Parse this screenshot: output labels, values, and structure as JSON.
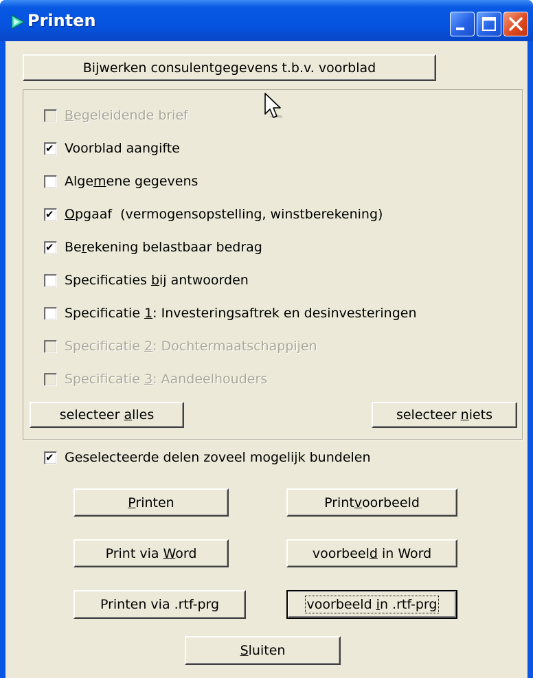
{
  "window": {
    "title": "Printen",
    "accent": "#0a55e3",
    "face": "#ece9d8"
  },
  "titlebar_buttons": [
    {
      "name": "minimize-icon"
    },
    {
      "name": "maximize-icon"
    },
    {
      "name": "close-icon"
    }
  ],
  "update_button": {
    "label": "Bijwerken consulentgegevens t.b.v. voorblad"
  },
  "sections": [
    {
      "pre": "",
      "key": "B",
      "post": "egeleidende brief",
      "checked": false,
      "enabled": false
    },
    {
      "pre": "Voorblad aan",
      "key": "g",
      "post": "ifte",
      "checked": true,
      "enabled": true
    },
    {
      "pre": "Alge",
      "key": "m",
      "post": "ene gegevens",
      "checked": false,
      "enabled": true
    },
    {
      "pre": "",
      "key": "O",
      "post": "pgaaf  (vermogensopstelling, winstberekening)",
      "checked": true,
      "enabled": true
    },
    {
      "pre": "Be",
      "key": "r",
      "post": "ekening belastbaar bedrag",
      "checked": true,
      "enabled": true
    },
    {
      "pre": "Specificaties ",
      "key": "b",
      "post": "ij antwoorden",
      "checked": false,
      "enabled": true
    },
    {
      "pre": "Specificatie ",
      "key": "1",
      "post": ": Investeringsaftrek en desinvesteringen",
      "checked": false,
      "enabled": true
    },
    {
      "pre": "Specificatie ",
      "key": "2",
      "post": ": Dochtermaatschappijen",
      "checked": false,
      "enabled": false
    },
    {
      "pre": "Specificatie ",
      "key": "3",
      "post": ": Aandeelhouders",
      "checked": false,
      "enabled": false
    }
  ],
  "select_all": {
    "pre": "selecteer ",
    "key": "a",
    "post": "lles"
  },
  "select_none": {
    "pre": "selecteer ",
    "key": "n",
    "post": "iets"
  },
  "bundle": {
    "label": "Geselecteerde delen zoveel mogelijk bundelen",
    "checked": true
  },
  "actions": {
    "print": {
      "pre": "",
      "key": "P",
      "post": "rinten"
    },
    "preview": {
      "pre": "Print",
      "key": "v",
      "post": "oorbeeld"
    },
    "print_word": {
      "pre": "Print via ",
      "key": "W",
      "post": "ord"
    },
    "preview_word": {
      "pre": "voorbeel",
      "key": "d",
      "post": " in Word"
    },
    "print_rtf": {
      "pre": "Printen via .rtf-prg",
      "key": "",
      "post": ""
    },
    "preview_rtf": {
      "pre": "voorbeeld ",
      "key": "i",
      "post": "n .rtf-prg"
    },
    "close": {
      "pre": "",
      "key": "S",
      "post": "luiten"
    }
  }
}
